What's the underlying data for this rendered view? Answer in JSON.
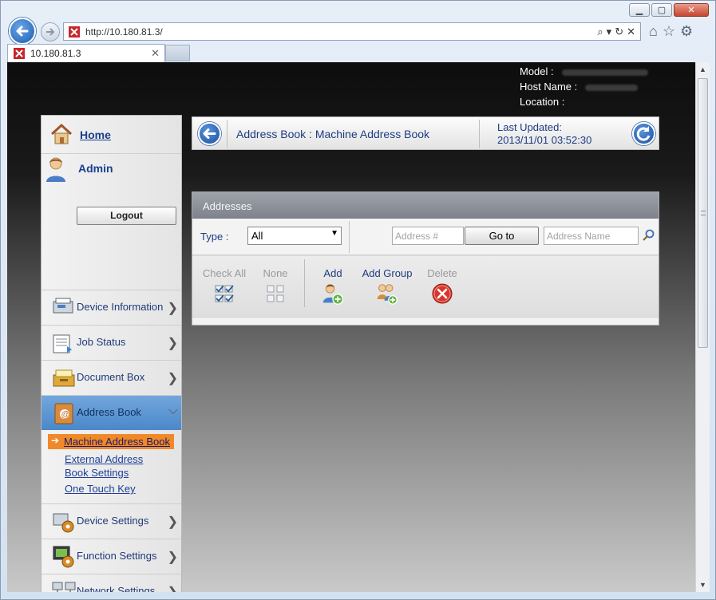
{
  "browser": {
    "url": "http://10.180.81.3/",
    "tab_title": "10.180.81.3",
    "window_controls": [
      "minimize",
      "maximize",
      "close"
    ]
  },
  "device": {
    "model_label": "Model :",
    "host_label": "Host Name :",
    "location_label": "Location :"
  },
  "sidebar": {
    "home": "Home",
    "admin": "Admin",
    "logout": "Logout",
    "menu": [
      {
        "label": "Device Information",
        "icon": "device-information-icon"
      },
      {
        "label": "Job Status",
        "icon": "job-status-icon"
      },
      {
        "label": "Document Box",
        "icon": "document-box-icon"
      },
      {
        "label": "Address Book",
        "icon": "address-book-icon",
        "expanded": true
      },
      {
        "label": "Device Settings",
        "icon": "device-settings-icon"
      },
      {
        "label": "Function Settings",
        "icon": "function-settings-icon"
      },
      {
        "label": "Network Settings",
        "icon": "network-settings-icon"
      }
    ],
    "submenu": {
      "active": "Machine Address Book",
      "external_line1": "External Address",
      "external_line2": "Book Settings",
      "one_touch": "One Touch Key"
    }
  },
  "header": {
    "title": "Address Book : Machine Address Book",
    "last_updated_label": "Last Updated:",
    "last_updated_value": "2013/11/01 03:52:30"
  },
  "addresses": {
    "heading": "Addresses",
    "type_label": "Type :",
    "type_value": "All",
    "address_num_placeholder": "Address #",
    "goto_label": "Go to",
    "address_name_placeholder": "Address Name",
    "actions": {
      "check_all": "Check All",
      "none": "None",
      "add": "Add",
      "add_group": "Add Group",
      "delete": "Delete"
    }
  },
  "colors": {
    "accent_blue": "#1d3c80",
    "active_menu": "#4b87c9",
    "active_submenu": "#f0892a",
    "delete_red": "#d9362b"
  }
}
